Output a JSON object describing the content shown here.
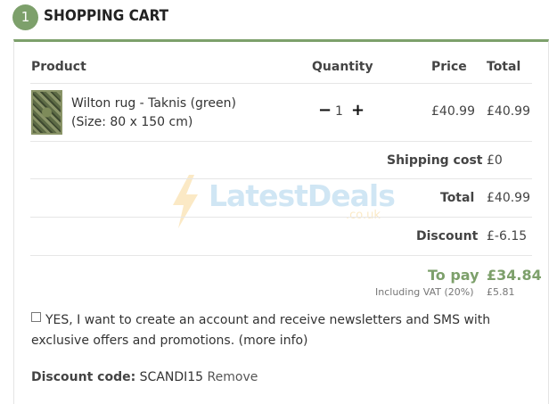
{
  "header": {
    "step_number": "1",
    "title": "SHOPPING CART"
  },
  "table": {
    "columns": [
      "Product",
      "Quantity",
      "Price",
      "Total"
    ]
  },
  "cart_item": {
    "name": "Wilton rug - Taknis (green)",
    "size": "(Size: 80 x 150 cm)",
    "quantity": "1",
    "minus_symbol": "−",
    "plus_symbol": "+",
    "price": "£40.99",
    "total": "£40.99"
  },
  "summary": {
    "shipping_label": "Shipping cost",
    "shipping_value": "£0",
    "total_label": "Total",
    "total_value": "£40.99",
    "discount_label": "Discount",
    "discount_value": "£-6.15",
    "topay_label": "To pay",
    "topay_value": "£34.84",
    "vat_label": "Including VAT (20%)",
    "vat_value": "£5.81"
  },
  "newsletter": {
    "text": "YES, I want to create an account and receive newsletters and SMS with exclusive offers and promotions. (more info)"
  },
  "discount_code": {
    "label": "Discount code:",
    "code": "SCANDI15",
    "remove_label": "Remove"
  },
  "watermark": {
    "text": "LatestDeals",
    "sub": ".co.uk"
  },
  "colors": {
    "accent_green": "#7da06b",
    "watermark_blue": "#5ba9d8",
    "watermark_orange": "#f2b431"
  }
}
